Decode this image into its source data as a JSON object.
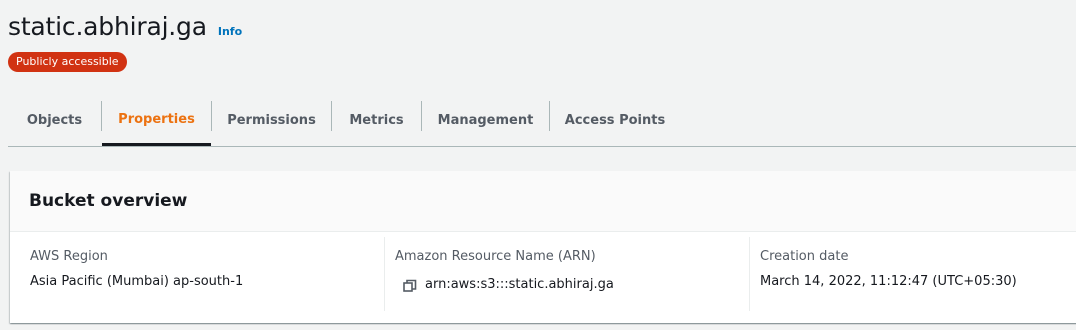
{
  "header": {
    "title": "static.abhiraj.ga",
    "info_label": "Info",
    "badge": "Publicly accessible"
  },
  "tabs": [
    {
      "label": "Objects",
      "active": false
    },
    {
      "label": "Properties",
      "active": true
    },
    {
      "label": "Permissions",
      "active": false
    },
    {
      "label": "Metrics",
      "active": false
    },
    {
      "label": "Management",
      "active": false
    },
    {
      "label": "Access Points",
      "active": false
    }
  ],
  "overview": {
    "title": "Bucket overview",
    "region_label": "AWS Region",
    "region_value": "Asia Pacific (Mumbai) ap-south-1",
    "arn_label": "Amazon Resource Name (ARN)",
    "arn_value": "arn:aws:s3:::static.abhiraj.ga",
    "arn_icon": "copy-icon",
    "creation_label": "Creation date",
    "creation_value": "March 14, 2022, 11:12:47 (UTC+05:30)"
  },
  "colors": {
    "badge_bg": "#d13212",
    "active_tab": "#ec7211",
    "link": "#0073bb"
  }
}
